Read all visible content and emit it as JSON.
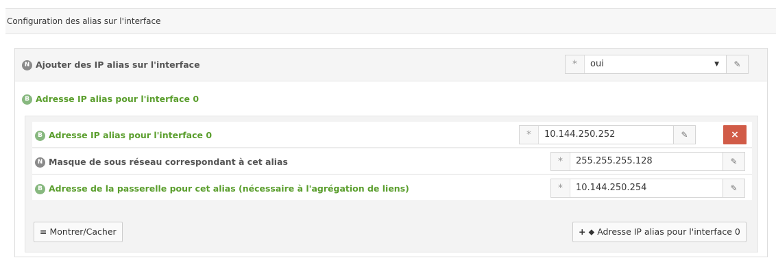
{
  "section": {
    "title": "Configuration des alias sur l'interface"
  },
  "option_add_alias": {
    "badge": "N",
    "label": "Ajouter des IP alias sur l'interface",
    "value": "oui"
  },
  "group": {
    "badge": "B",
    "title": "Adresse IP alias pour l'interface 0"
  },
  "fields": [
    {
      "badge": "B",
      "label": "Adresse IP alias pour l'interface 0",
      "value": "10.144.250.252"
    },
    {
      "badge": "N",
      "label": "Masque de sous réseau correspondant à cet alias",
      "value": "255.255.255.128"
    },
    {
      "badge": "B",
      "label": "Adresse de la passerelle pour cet alias (nécessaire à l'agrégation de liens)",
      "value": "10.144.250.254"
    }
  ],
  "buttons": {
    "toggle": "Montrer/Cacher",
    "add": "Adresse IP alias pour l'interface 0",
    "delete": "×"
  },
  "icons": {
    "required": "*",
    "edit": "✎",
    "menu": "≡",
    "plus": "+",
    "tag": "⬥",
    "caret": "▼"
  },
  "colors": {
    "green": "#5a9e2d",
    "badge_green": "#87b87f",
    "danger": "#d15b47"
  }
}
